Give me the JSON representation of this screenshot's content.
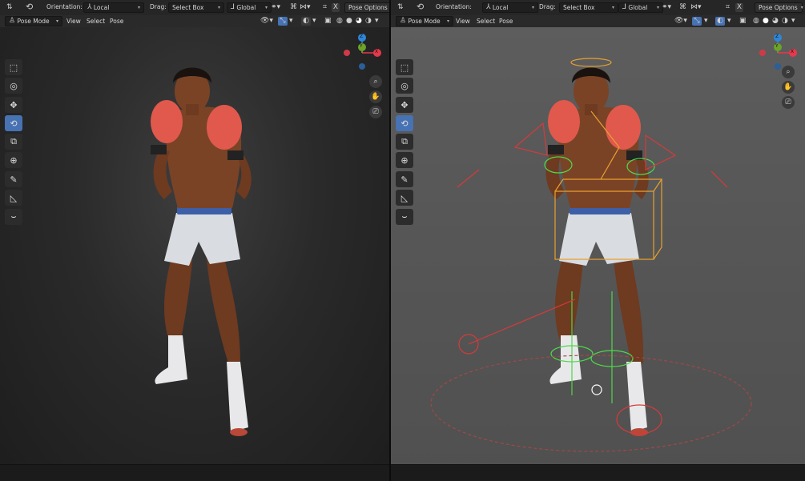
{
  "left": {
    "header": {
      "orientation_label": "Orientation:",
      "orientation_value": "Local",
      "drag_label": "Drag:",
      "drag_value": "Select Box",
      "transform_value": "Global",
      "options_label": "Pose Options"
    },
    "subheader": {
      "mode": "Pose Mode",
      "menu_view": "View",
      "menu_select": "Select",
      "menu_pose": "Pose"
    },
    "gizmo": {
      "z": "Z",
      "y": "Y",
      "x": "X"
    }
  },
  "right": {
    "header": {
      "orientation_label": "Orientation:",
      "orientation_value": "Local",
      "drag_label": "Drag:",
      "drag_value": "Select Box",
      "transform_value": "Global",
      "options_label": "Pose Options"
    },
    "subheader": {
      "mode": "Pose Mode",
      "menu_view": "View",
      "menu_select": "Select",
      "menu_pose": "Pose"
    },
    "gizmo": {
      "z": "Z",
      "y": "Y",
      "x": "X"
    }
  },
  "colors": {
    "active_tool": "#4772b3",
    "axis_x": "#e8384d",
    "axis_y": "#6ca329",
    "axis_z": "#2f86d9",
    "skin": "#7a4326",
    "glove": "#e0594c",
    "shorts": "#d9dde2",
    "waistband": "#3d5fa8",
    "rig_orange": "#e8a030",
    "rig_green": "#4ed84a",
    "rig_red": "#d63a3a"
  },
  "tools": [
    "select-box-icon",
    "cursor-icon",
    "move-icon",
    "rotate-icon",
    "scale-icon",
    "transform-icon",
    "annotate-icon",
    "measure-icon",
    "relax-icon"
  ]
}
